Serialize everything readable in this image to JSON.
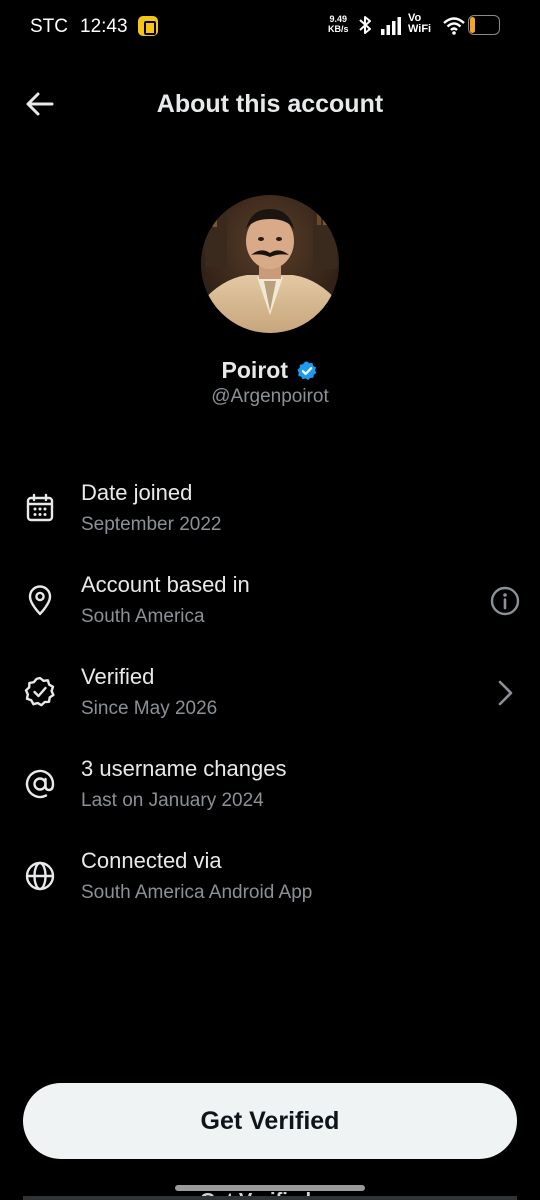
{
  "status_bar": {
    "carrier": "STC",
    "time": "12:43",
    "net_speed_value": "9.49",
    "net_speed_unit": "KB/s",
    "vowifi_top": "Vo",
    "vowifi_bottom": "WiFi",
    "battery": "18",
    "battery_level": 0.18
  },
  "header": {
    "title": "About this account"
  },
  "profile": {
    "display_name": "Poirot",
    "handle": "@Argenpoirot",
    "verified": true,
    "badge_color": "#1d9bf0"
  },
  "info_rows": [
    {
      "icon": "calendar-icon",
      "title": "Date joined",
      "subtitle": "September 2022"
    },
    {
      "icon": "location-pin-icon",
      "title": "Account based in",
      "subtitle": "South America",
      "trailing": "info-icon"
    },
    {
      "icon": "verified-icon",
      "title": "Verified",
      "subtitle": "Since May 2026",
      "trailing": "chevron-right-icon"
    },
    {
      "icon": "at-sign-icon",
      "title": "3 username changes",
      "subtitle": "Last on January 2024"
    },
    {
      "icon": "globe-icon",
      "title": "Connected via",
      "subtitle": "South America Android App"
    }
  ],
  "cta": {
    "label": "Get Verified"
  },
  "behind_text": "Get Verified",
  "colors": {
    "background": "#000000",
    "text_primary": "#e7e9ea",
    "text_secondary": "#8b9197",
    "button_bg": "#eff3f4",
    "accent": "#1d9bf0"
  }
}
